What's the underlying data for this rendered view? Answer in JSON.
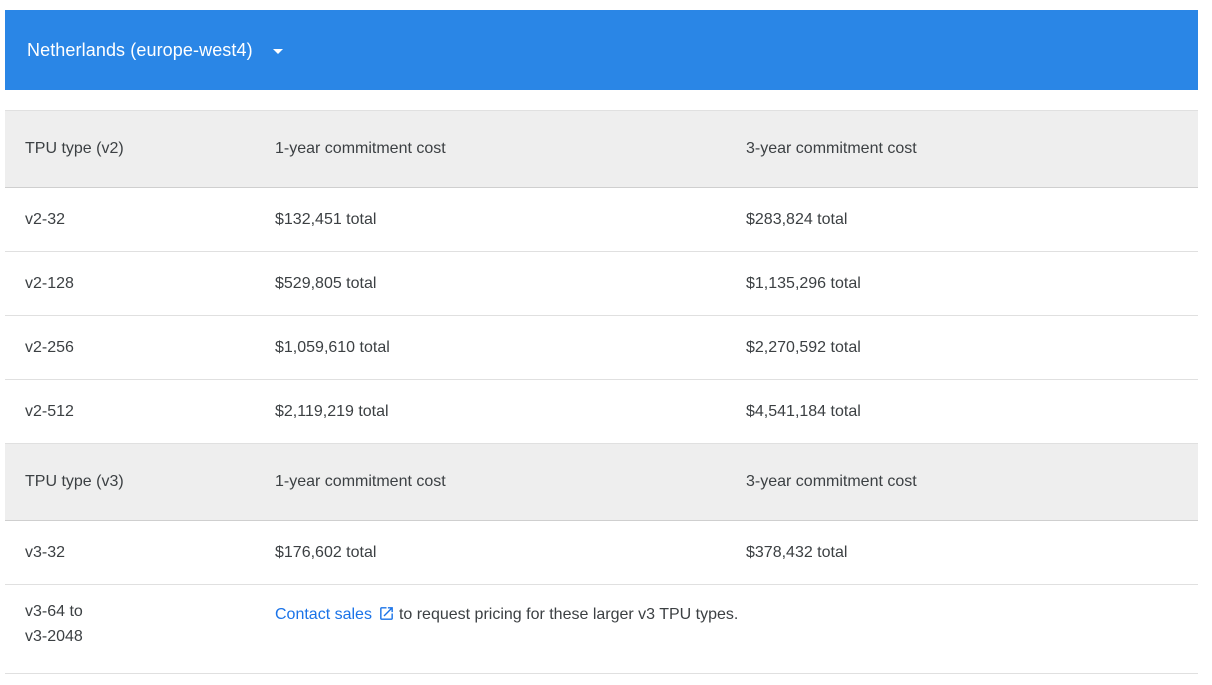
{
  "region": {
    "label": "Netherlands (europe-west4)",
    "dropdown_icon": "arrow-drop-down-icon"
  },
  "colors": {
    "region_bar": "#2a86e6",
    "header_row": "#eeeeee",
    "link": "#1a73e8"
  },
  "v2_table": {
    "headers": [
      "TPU type (v2)",
      "1-year commitment cost",
      "3-year commitment cost"
    ],
    "rows": [
      [
        "v2-32",
        "$132,451 total",
        "$283,824 total"
      ],
      [
        "v2-128",
        "$529,805 total",
        "$1,135,296 total"
      ],
      [
        "v2-256",
        "$1,059,610 total",
        "$2,270,592 total"
      ],
      [
        "v2-512",
        "$2,119,219 total",
        "$4,541,184 total"
      ]
    ]
  },
  "v3_table": {
    "headers": [
      "TPU type (v3)",
      "1-year commitment cost",
      "3-year commitment cost"
    ],
    "rows": [
      [
        "v3-32",
        "$176,602 total",
        "$378,432 total"
      ]
    ],
    "large_types": {
      "type_line1": "v3-64 to",
      "type_line2": "v3-2048",
      "contact_link": "Contact sales",
      "link_icon": "open-in-new-icon",
      "message": "to request pricing for these larger v3 TPU types."
    }
  }
}
